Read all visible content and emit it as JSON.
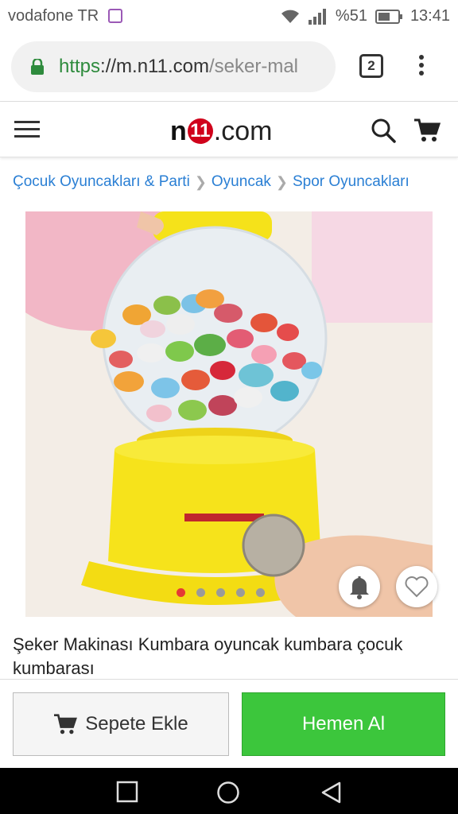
{
  "status_bar": {
    "carrier": "vodafone TR",
    "battery": "%51",
    "time": "13:41"
  },
  "browser": {
    "url_scheme": "https",
    "url_sep": "://",
    "url_host": "m.n11.com",
    "url_path": "/seker-mal",
    "tab_count": "2"
  },
  "site": {
    "logo_prefix": "n",
    "logo_badge": "11",
    "logo_suffix": ".com"
  },
  "breadcrumb": [
    "Çocuk Oyuncakları & Parti",
    "Oyuncak",
    "Spor Oyuncakları"
  ],
  "carousel": {
    "total": 5,
    "active_index": 0
  },
  "product": {
    "title": "Şeker Makinası Kumbara oyuncak kumbara çocuk kumbarası"
  },
  "actions": {
    "add_to_cart": "Sepete Ekle",
    "buy_now": "Hemen Al"
  },
  "colors": {
    "accent_green": "#3cc63c",
    "link_blue": "#2a7fd4",
    "brand_red": "#d0021b"
  }
}
